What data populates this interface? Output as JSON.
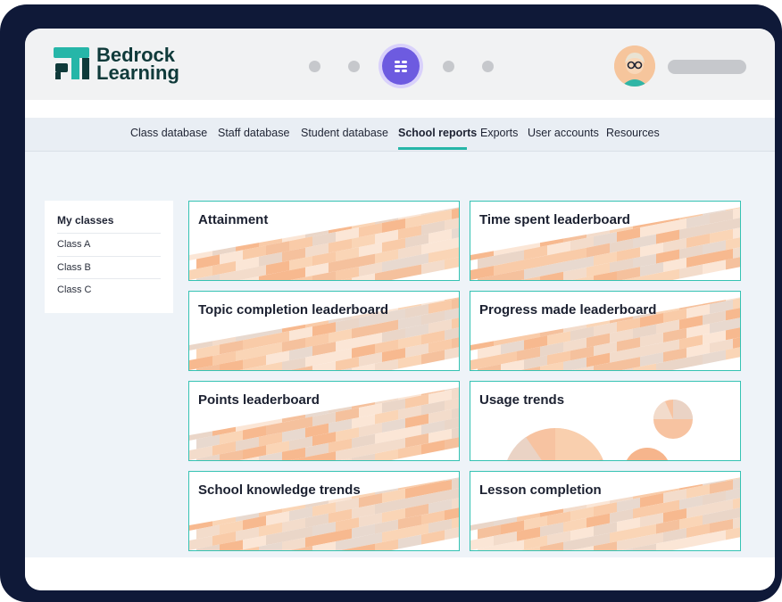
{
  "brand": {
    "name_line1": "Bedrock",
    "name_line2": "Learning",
    "colors": {
      "teal": "#26b6a8",
      "dark": "#0f3a3a",
      "purple": "#6d5be0",
      "frame": "#0f1938",
      "peach": "#f7b98f"
    }
  },
  "header": {
    "app_icon": "apps-menu-icon",
    "avatar": "user-avatar-icon"
  },
  "nav": {
    "items": [
      {
        "label": "Class database"
      },
      {
        "label": "Staff database"
      },
      {
        "label": "Student database"
      },
      {
        "label": "School reports",
        "active": true
      },
      {
        "label": "Exports"
      },
      {
        "label": "User accounts"
      },
      {
        "label": "Resources"
      }
    ]
  },
  "sidebar": {
    "title": "My classes",
    "items": [
      "Class A",
      "Class B",
      "Class C"
    ]
  },
  "reports": [
    {
      "title": "Attainment"
    },
    {
      "title": "Time spent leaderboard"
    },
    {
      "title": "Topic completion leaderboard"
    },
    {
      "title": "Progress made leaderboard"
    },
    {
      "title": "Points leaderboard"
    },
    {
      "title": "Usage trends"
    },
    {
      "title": "School knowledge trends"
    },
    {
      "title": "Lesson completion"
    }
  ]
}
